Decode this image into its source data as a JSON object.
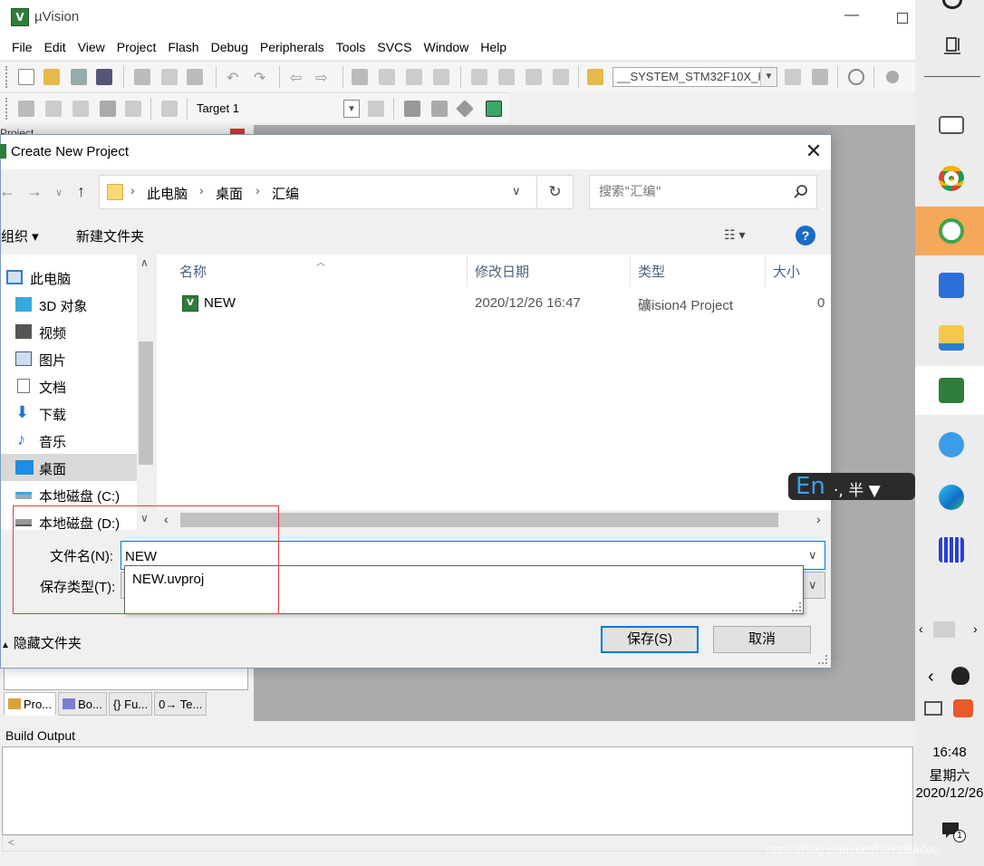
{
  "app": {
    "title": "µVision",
    "menu": [
      "File",
      "Edit",
      "View",
      "Project",
      "Flash",
      "Debug",
      "Peripherals",
      "Tools",
      "SVCS",
      "Window",
      "Help"
    ],
    "toolbar_combo": "__SYSTEM_STM32F10X_H",
    "target_combo": "Target 1",
    "project_pane_title": "Project",
    "panel_tabs": [
      "Pro...",
      "Bo...",
      "{} Fu...",
      "0→ Te..."
    ],
    "build_output_title": "Build Output",
    "scroll_left": "<"
  },
  "dialog": {
    "title": "Create New Project",
    "close_glyph": "✕",
    "breadcrumbs": [
      "此电脑",
      "桌面",
      "汇编"
    ],
    "search_placeholder": "搜索\"汇编\"",
    "commands": {
      "organize": "组织 ▾",
      "new_folder": "新建文件夹"
    },
    "view_glyph": "☷ ▾",
    "help_glyph": "?",
    "nav_items": [
      "此电脑",
      "3D 对象",
      "视频",
      "图片",
      "文档",
      "下载",
      "音乐",
      "桌面",
      "本地磁盘 (C:)",
      "本地磁盘 (D:)"
    ],
    "nav_selected": "桌面",
    "columns": [
      "名称",
      "修改日期",
      "类型",
      "大小"
    ],
    "files": [
      {
        "name": "NEW",
        "modified": "2020/12/26 16:47",
        "type": "礦ision4 Project",
        "size": "0"
      }
    ],
    "filename_label": "文件名(N):",
    "filename_value": "NEW",
    "filetype_label": "保存类型(T):",
    "autocomplete": [
      "NEW.uvproj"
    ],
    "hide_folders": "隐藏文件夹",
    "save_button": "保存(S)",
    "cancel_button": "取消"
  },
  "taskbar": {
    "active_app": "360-browser",
    "apps": [
      "display-switch",
      "chrome",
      "360-browser",
      "wps-writer",
      "file-explorer",
      "keil-uvision",
      "360-security",
      "edge",
      "unknown-app"
    ],
    "ime": {
      "lang": "En",
      "rest": "·, 半 ▼"
    },
    "clock": {
      "time": "16:48",
      "weekday": "星期六",
      "date": "2020/12/26"
    },
    "notification_count": "1"
  },
  "watermark": "https://blog.csdn.net/hsnsnbadoo",
  "colors": {
    "accent": "#0078d7",
    "keil_green": "#2f7d3a",
    "active_taskbar": "#f5a85a",
    "annotation_red": "#e0403a"
  }
}
